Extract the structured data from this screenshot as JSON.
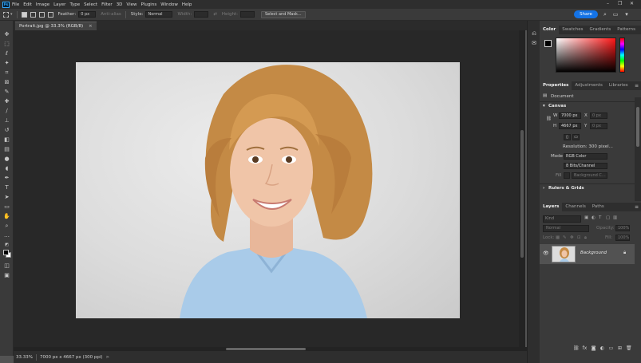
{
  "menubar": {
    "items": [
      "File",
      "Edit",
      "Image",
      "Layer",
      "Type",
      "Select",
      "Filter",
      "3D",
      "View",
      "Plugins",
      "Window",
      "Help"
    ],
    "window_controls": [
      "–",
      "❐",
      "✕"
    ]
  },
  "options": {
    "feather_label": "Feather:",
    "feather_value": "0 px",
    "anti_alias_label": "Anti-alias",
    "style_label": "Style:",
    "style_value": "Normal",
    "width_label": "Width:",
    "height_label": "Height:",
    "select_mask_label": "Select and Mask...",
    "share_label": "Share"
  },
  "document": {
    "tab_title": "Portrait.jpg @ 33.3% (RGB/8)",
    "tab_close": "×"
  },
  "status": {
    "zoom": "33.33%",
    "doc_info": "7000 px x 4667 px (300 ppi)",
    "arrow": ">"
  },
  "color_panel": {
    "tabs": [
      "Color",
      "Swatches",
      "Gradients",
      "Patterns"
    ],
    "fg_color": "#000000",
    "bg_color": "#ffffff"
  },
  "properties_panel": {
    "tabs": [
      "Properties",
      "Adjustments",
      "Libraries"
    ],
    "doc_label": "Document",
    "canvas_heading": "Canvas",
    "w_label": "W",
    "w_value": "7000 px",
    "x_label": "X",
    "x_value": "0 px",
    "h_label": "H",
    "h_value": "4667 px",
    "y_label": "Y",
    "y_value": "0 px",
    "resolution": "Resolution: 300 pixel...",
    "mode_label": "Mode",
    "mode_value": "RGB Color",
    "bit_value": "8 Bits/Channel",
    "fill_label": "Fill",
    "fill_value": "Background C...",
    "rulers_heading": "Rulers & Grids"
  },
  "layers_panel": {
    "tabs": [
      "Layers",
      "Channels",
      "Paths"
    ],
    "search_placeholder": "Kind",
    "blend_mode": "Normal",
    "opacity_label": "Opacity:",
    "opacity_value": "100%",
    "lock_label": "Lock:",
    "fill_label": "Fill:",
    "fill_value": "100%",
    "layer_name": "Background"
  },
  "accent_color": "#1473e6"
}
